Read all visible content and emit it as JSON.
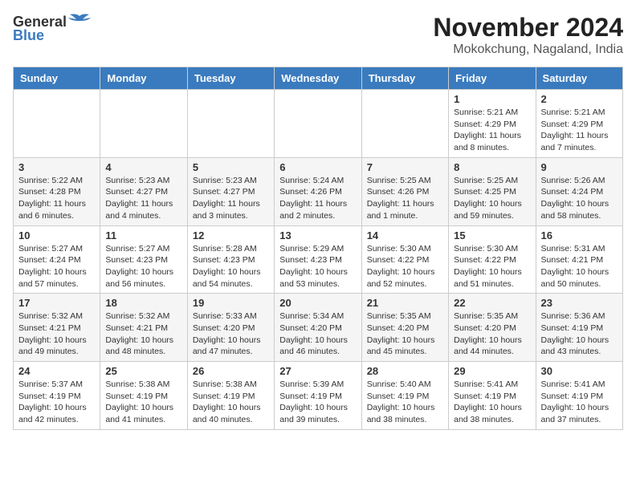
{
  "header": {
    "logo_general": "General",
    "logo_blue": "Blue",
    "month_title": "November 2024",
    "location": "Mokokchung, Nagalnd, India"
  },
  "days_of_week": [
    "Sunday",
    "Monday",
    "Tuesday",
    "Wednesday",
    "Thursday",
    "Friday",
    "Saturday"
  ],
  "weeks": [
    [
      {
        "day": "",
        "info": ""
      },
      {
        "day": "",
        "info": ""
      },
      {
        "day": "",
        "info": ""
      },
      {
        "day": "",
        "info": ""
      },
      {
        "day": "",
        "info": ""
      },
      {
        "day": "1",
        "info": "Sunrise: 5:21 AM\nSunset: 4:29 PM\nDaylight: 11 hours and 8 minutes."
      },
      {
        "day": "2",
        "info": "Sunrise: 5:21 AM\nSunset: 4:29 PM\nDaylight: 11 hours and 7 minutes."
      }
    ],
    [
      {
        "day": "3",
        "info": "Sunrise: 5:22 AM\nSunset: 4:28 PM\nDaylight: 11 hours and 6 minutes."
      },
      {
        "day": "4",
        "info": "Sunrise: 5:23 AM\nSunset: 4:27 PM\nDaylight: 11 hours and 4 minutes."
      },
      {
        "day": "5",
        "info": "Sunrise: 5:23 AM\nSunset: 4:27 PM\nDaylight: 11 hours and 3 minutes."
      },
      {
        "day": "6",
        "info": "Sunrise: 5:24 AM\nSunset: 4:26 PM\nDaylight: 11 hours and 2 minutes."
      },
      {
        "day": "7",
        "info": "Sunrise: 5:25 AM\nSunset: 4:26 PM\nDaylight: 11 hours and 1 minute."
      },
      {
        "day": "8",
        "info": "Sunrise: 5:25 AM\nSunset: 4:25 PM\nDaylight: 10 hours and 59 minutes."
      },
      {
        "day": "9",
        "info": "Sunrise: 5:26 AM\nSunset: 4:24 PM\nDaylight: 10 hours and 58 minutes."
      }
    ],
    [
      {
        "day": "10",
        "info": "Sunrise: 5:27 AM\nSunset: 4:24 PM\nDaylight: 10 hours and 57 minutes."
      },
      {
        "day": "11",
        "info": "Sunrise: 5:27 AM\nSunset: 4:23 PM\nDaylight: 10 hours and 56 minutes."
      },
      {
        "day": "12",
        "info": "Sunrise: 5:28 AM\nSunset: 4:23 PM\nDaylight: 10 hours and 54 minutes."
      },
      {
        "day": "13",
        "info": "Sunrise: 5:29 AM\nSunset: 4:23 PM\nDaylight: 10 hours and 53 minutes."
      },
      {
        "day": "14",
        "info": "Sunrise: 5:30 AM\nSunset: 4:22 PM\nDaylight: 10 hours and 52 minutes."
      },
      {
        "day": "15",
        "info": "Sunrise: 5:30 AM\nSunset: 4:22 PM\nDaylight: 10 hours and 51 minutes."
      },
      {
        "day": "16",
        "info": "Sunrise: 5:31 AM\nSunset: 4:21 PM\nDaylight: 10 hours and 50 minutes."
      }
    ],
    [
      {
        "day": "17",
        "info": "Sunrise: 5:32 AM\nSunset: 4:21 PM\nDaylight: 10 hours and 49 minutes."
      },
      {
        "day": "18",
        "info": "Sunrise: 5:32 AM\nSunset: 4:21 PM\nDaylight: 10 hours and 48 minutes."
      },
      {
        "day": "19",
        "info": "Sunrise: 5:33 AM\nSunset: 4:20 PM\nDaylight: 10 hours and 47 minutes."
      },
      {
        "day": "20",
        "info": "Sunrise: 5:34 AM\nSunset: 4:20 PM\nDaylight: 10 hours and 46 minutes."
      },
      {
        "day": "21",
        "info": "Sunrise: 5:35 AM\nSunset: 4:20 PM\nDaylight: 10 hours and 45 minutes."
      },
      {
        "day": "22",
        "info": "Sunrise: 5:35 AM\nSunset: 4:20 PM\nDaylight: 10 hours and 44 minutes."
      },
      {
        "day": "23",
        "info": "Sunrise: 5:36 AM\nSunset: 4:19 PM\nDaylight: 10 hours and 43 minutes."
      }
    ],
    [
      {
        "day": "24",
        "info": "Sunrise: 5:37 AM\nSunset: 4:19 PM\nDaylight: 10 hours and 42 minutes."
      },
      {
        "day": "25",
        "info": "Sunrise: 5:38 AM\nSunset: 4:19 PM\nDaylight: 10 hours and 41 minutes."
      },
      {
        "day": "26",
        "info": "Sunrise: 5:38 AM\nSunset: 4:19 PM\nDaylight: 10 hours and 40 minutes."
      },
      {
        "day": "27",
        "info": "Sunrise: 5:39 AM\nSunset: 4:19 PM\nDaylight: 10 hours and 39 minutes."
      },
      {
        "day": "28",
        "info": "Sunrise: 5:40 AM\nSunset: 4:19 PM\nDaylight: 10 hours and 38 minutes."
      },
      {
        "day": "29",
        "info": "Sunrise: 5:41 AM\nSunset: 4:19 PM\nDaylight: 10 hours and 38 minutes."
      },
      {
        "day": "30",
        "info": "Sunrise: 5:41 AM\nSunset: 4:19 PM\nDaylight: 10 hours and 37 minutes."
      }
    ]
  ]
}
